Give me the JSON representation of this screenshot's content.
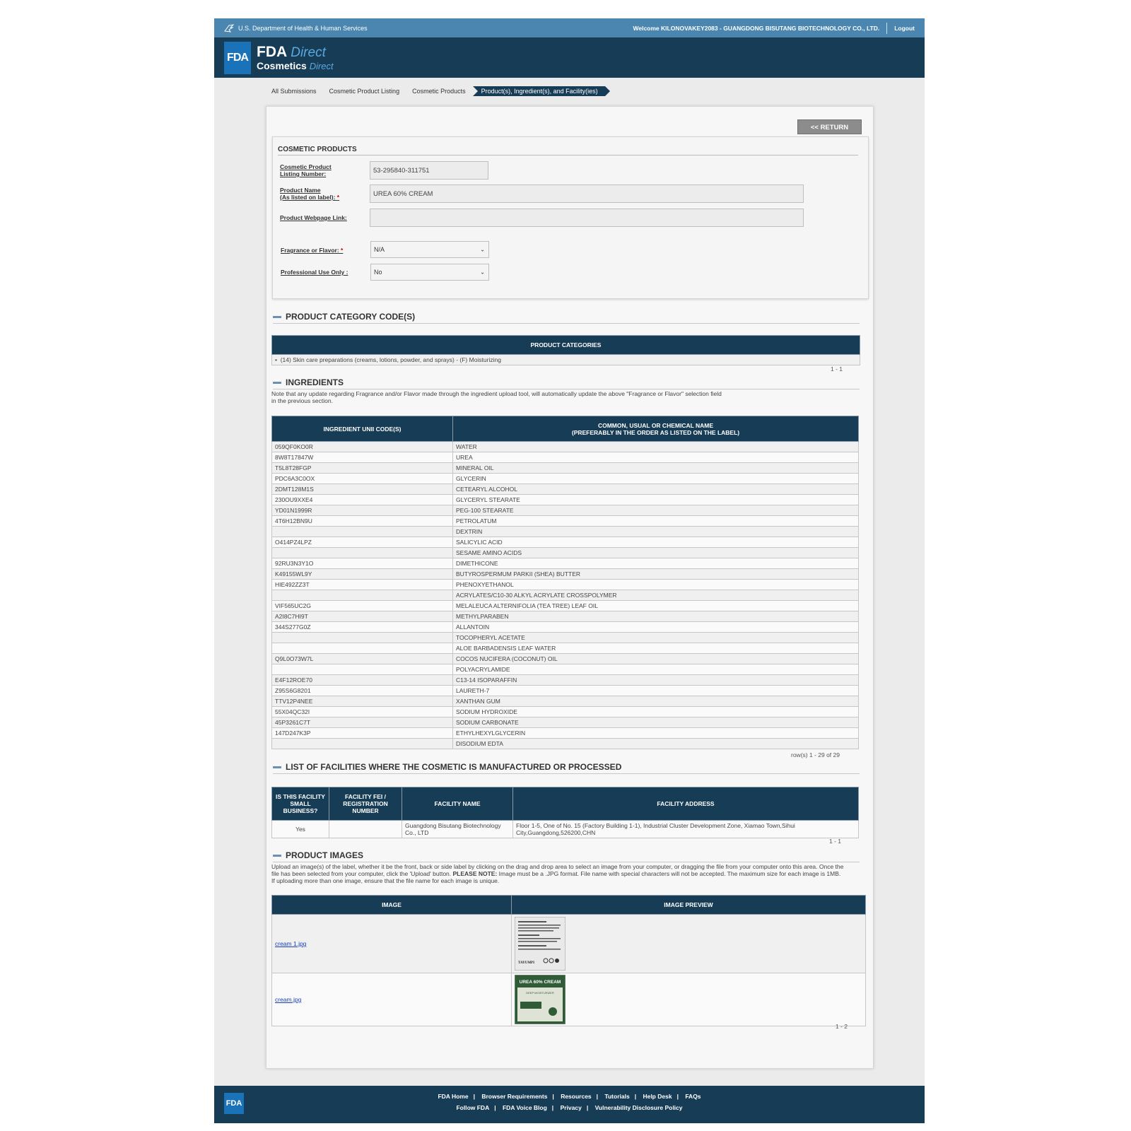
{
  "hhs": {
    "department": "U.S. Department of Health & Human Services",
    "welcome": "Welcome KILONOVAKEY2083 - GUANGDONG BISUTANG BIOTECHNOLOGY CO., LTD.",
    "logout": "Logout"
  },
  "brand": {
    "logo": "FDA",
    "line1_bold": "FDA",
    "line1_italic": "Direct",
    "line2_bold": "Cosmetics",
    "line2_italic": "Direct"
  },
  "breadcrumb": [
    "All Submissions",
    "Cosmetic Product Listing",
    "Cosmetic Products",
    "Product(s), Ingredient(s), and Facility(ies)"
  ],
  "return_label": "<< RETURN",
  "cosmetic_products": {
    "title": "COSMETIC PRODUCTS",
    "listing_label_1": "Cosmetic Product",
    "listing_label_2": "Listing Number:",
    "listing_value": "53-295840-311751",
    "name_label_1": "Product Name",
    "name_label_2": "(As listed on label):",
    "name_value": "UREA 60% CREAM",
    "webpage_label": "Product Webpage Link:",
    "webpage_value": "",
    "fragrance_label": "Fragrance or Flavor:",
    "fragrance_value": "N/A",
    "professional_label": "Professional Use Only :",
    "professional_value": "No",
    "required_mark": "*"
  },
  "categories": {
    "title": "PRODUCT CATEGORY CODE(S)",
    "header": "PRODUCT CATEGORIES",
    "item": "(14) Skin care preparations (creams, lotions, powder, and sprays) - (F) Moisturizing",
    "pager": "1 - 1"
  },
  "ingredients": {
    "title": "INGREDIENTS",
    "note_1": "Note that any update regarding Fragrance and/or Flavor made through the ingredient upload tool, will automatically update the above \"Fragrance or Flavor\" selection field",
    "note_2": "in the previous section.",
    "col_code": "INGREDIENT UNII CODE(S)",
    "col_name_1": "COMMON, USUAL OR CHEMICAL NAME",
    "col_name_2": "(PREFERABLY IN THE ORDER AS LISTED ON THE LABEL)",
    "rows": [
      [
        "059QF0KO0R",
        "WATER"
      ],
      [
        "8W8T17847W",
        "UREA"
      ],
      [
        "T5L8T28FGP",
        "MINERAL OIL"
      ],
      [
        "PDC6A3C0OX",
        "GLYCERIN"
      ],
      [
        "2DMT128M1S",
        "CETEARYL ALCOHOL"
      ],
      [
        "230OU9XXE4",
        "GLYCERYL STEARATE"
      ],
      [
        "YD01N1999R",
        "PEG-100 STEARATE"
      ],
      [
        "4T6H12BN9U",
        "PETROLATUM"
      ],
      [
        "",
        "DEXTRIN"
      ],
      [
        "O414PZ4LPZ",
        "SALICYLIC ACID"
      ],
      [
        "",
        "SESAME AMINO ACIDS"
      ],
      [
        "92RU3N3Y1O",
        "DIMETHICONE"
      ],
      [
        "K49155WL9Y",
        "BUTYROSPERMUM PARKII (SHEA) BUTTER"
      ],
      [
        "HIE492ZZ3T",
        "PHENOXYETHANOL"
      ],
      [
        "",
        "ACRYLATES/C10-30 ALKYL ACRYLATE CROSSPOLYMER"
      ],
      [
        "VIF565UC2G",
        "MELALEUCA ALTERNIFOLIA (TEA TREE) LEAF OIL"
      ],
      [
        "A2I8C7HI9T",
        "METHYLPARABEN"
      ],
      [
        "344S277G0Z",
        "ALLANTOIN"
      ],
      [
        "",
        "TOCOPHERYL ACETATE"
      ],
      [
        "",
        "ALOE BARBADENSIS LEAF WATER"
      ],
      [
        "Q9L0O73W7L",
        "COCOS NUCIFERA (COCONUT) OIL"
      ],
      [
        "",
        "POLYACRYLAMIDE"
      ],
      [
        "E4F12ROE70",
        "C13-14 ISOPARAFFIN"
      ],
      [
        "Z95S6G8201",
        "LAURETH-7"
      ],
      [
        "TTV12P4NEE",
        "XANTHAN GUM"
      ],
      [
        "55X04QC32I",
        "SODIUM HYDROXIDE"
      ],
      [
        "45P3261C7T",
        "SODIUM CARBONATE"
      ],
      [
        "147D247K3P",
        "ETHYLHEXYLGLYCERIN"
      ],
      [
        "",
        "DISODIUM EDTA"
      ]
    ],
    "pager": "row(s) 1 - 29 of 29"
  },
  "facilities": {
    "title": "LIST OF FACILITIES WHERE THE COSMETIC IS MANUFACTURED OR PROCESSED",
    "col_small_1": "IS THIS FACILITY",
    "col_small_2": "SMALL",
    "col_small_3": "BUSINESS?",
    "col_fei_1": "FACILITY FEI /",
    "col_fei_2": "REGISTRATION",
    "col_fei_3": "NUMBER",
    "col_name": "FACILITY NAME",
    "col_address": "FACILITY ADDRESS",
    "small": "Yes",
    "fei": "",
    "name_1": "Guangdong Bisutang Biotechnology",
    "name_2": "Co., LTD",
    "address_1": "Floor 1-5, One of No. 15 (Factory Building 1-1), Industrial Cluster Development Zone, Xiamao Town,Sihui",
    "address_2": "City,Guangdong,526200,CHN",
    "pager": "1 - 1"
  },
  "images": {
    "title": "PRODUCT IMAGES",
    "note_1": "Upload an image(s) of the label, whether it be the front, back or side label by clicking on the drag and drop area to select an image from your computer, or dragging the file from your computer onto this area. Once the",
    "note_2a": "file has been selected from your computer, click the 'Upload' button. ",
    "note_2b": "PLEASE NOTE:",
    "note_2c": " Image must be a .JPG format. File name with special characters will not be accepted. The maximum size for each image is 1MB.",
    "note_3": "If uploading more than one image, ensure that the file name for each image is unique.",
    "col_image": "IMAGE",
    "col_preview": "IMAGE PREVIEW",
    "file_1": "cream 1.jpg",
    "file_2": "cream.jpg",
    "label_brand": "TAYUMPI",
    "label_product": "UREA 60% CREAM",
    "label_subtitle": "DEEP MOISTURIZER",
    "pager": "1 - 2"
  },
  "footer": {
    "logo": "FDA",
    "row1": [
      "FDA Home",
      "Browser Requirements",
      "Resources",
      "Tutorials",
      "Help Desk",
      "FAQs"
    ],
    "row2": [
      "Follow FDA",
      "FDA Voice Blog",
      "Privacy",
      "Vulnerability Disclosure Policy"
    ]
  },
  "colors": {
    "navy": "#173c56",
    "hhs_blue": "#4a86b0",
    "logo_blue": "#1a73b8"
  }
}
